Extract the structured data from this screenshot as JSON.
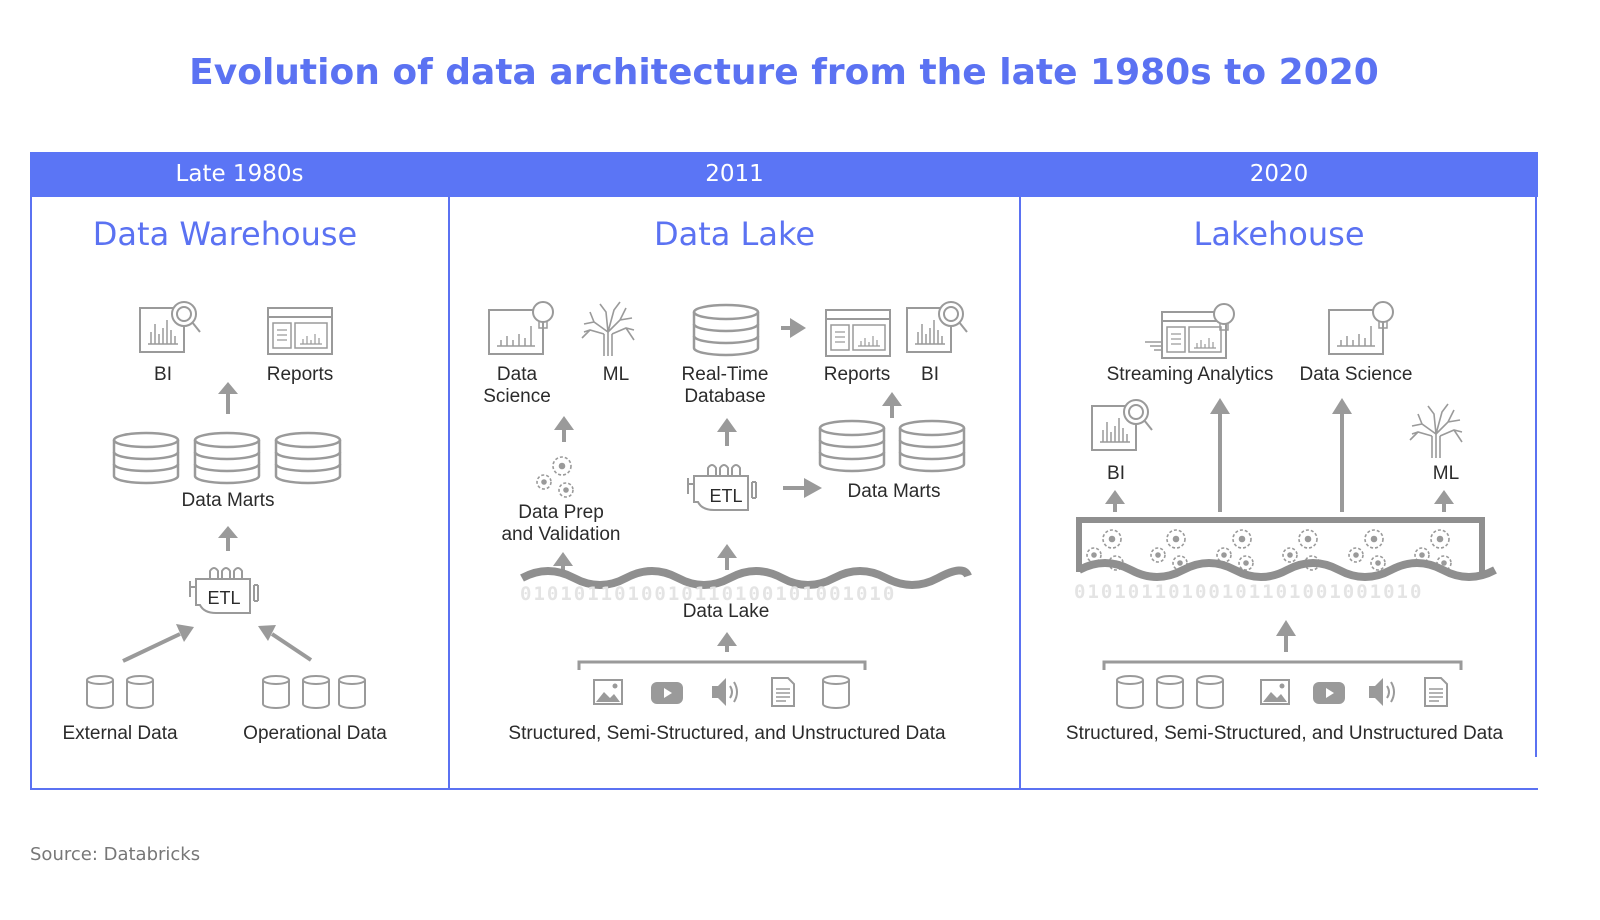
{
  "title": "Evolution of data architecture from the late 1980s to 2020",
  "source": "Source: Databricks",
  "theme": {
    "accent": "#5b72f2",
    "header_bg": "#5b75f5",
    "icon_gray": "#9a9a9a",
    "text_dark": "#2b2b2b"
  },
  "columns": [
    {
      "era": "Late 1980s",
      "name": "Data Warehouse",
      "labels": {
        "bi": "BI",
        "reports": "Reports",
        "data_marts": "Data Marts",
        "etl": "ETL",
        "external_data": "External Data",
        "operational_data": "Operational Data"
      },
      "flow": [
        "External Data",
        "Operational Data",
        "ETL",
        "Data Marts",
        "BI",
        "Reports"
      ]
    },
    {
      "era": "2011",
      "name": "Data Lake",
      "labels": {
        "data_science_1": "Data",
        "data_science_2": "Science",
        "ml": "ML",
        "rtdb_1": "Real-Time",
        "rtdb_2": "Database",
        "reports": "Reports",
        "bi": "BI",
        "data_prep_1": "Data Prep",
        "data_prep_2": "and Validation",
        "etl": "ETL",
        "data_marts": "Data Marts",
        "data_lake": "Data Lake",
        "sources": "Structured, Semi-Structured, and Unstructured Data"
      },
      "source_icons": [
        "image-icon",
        "video-icon",
        "audio-icon",
        "document-icon",
        "database-icon"
      ],
      "binary": "0101011010010110100101001010"
    },
    {
      "era": "2020",
      "name": "Lakehouse",
      "labels": {
        "streaming": "Streaming Analytics",
        "data_science": "Data Science",
        "bi": "BI",
        "ml": "ML",
        "sources": "Structured, Semi-Structured, and Unstructured Data"
      },
      "source_icons": [
        "database-icon",
        "database-icon",
        "database-icon",
        "image-icon",
        "video-icon",
        "audio-icon",
        "document-icon"
      ],
      "binary": "01010110100101101001001010"
    }
  ]
}
